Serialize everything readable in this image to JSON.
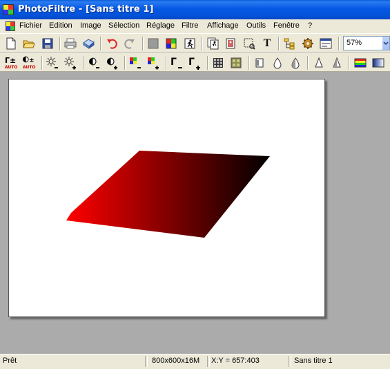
{
  "window": {
    "title": "PhotoFiltre - [Sans titre 1]"
  },
  "menu": [
    "Fichier",
    "Edition",
    "Image",
    "Sélection",
    "Réglage",
    "Filtre",
    "Affichage",
    "Outils",
    "Fenêtre",
    "?"
  ],
  "toolbar1": {
    "buttons": [
      "new-file-icon",
      "open-folder-icon",
      "save-icon",
      "print-icon",
      "scanner-icon",
      "undo-icon",
      "redo-icon",
      "gray-square-icon",
      "color-palette-icon",
      "run-icon",
      "export-icon",
      "import-icon",
      "magic-wand-icon",
      "text-tool-icon",
      "browser-icon",
      "settings-icon",
      "window-icon"
    ],
    "zoom_value": "57%",
    "text_tool_label": "T"
  },
  "toolbar2": {
    "auto_label": "AUTO",
    "buttons": [
      "auto-levels-icon",
      "auto-contrast-icon",
      "brightness-minus-icon",
      "brightness-plus-icon",
      "contrast-minus-icon",
      "contrast-plus-icon",
      "saturation-minus-icon",
      "saturation-plus-icon",
      "gamma-minus-icon",
      "gamma-plus-icon",
      "grid-icon",
      "texture-icon",
      "frame-icon",
      "blur-icon",
      "sharpen-icon",
      "drop-icon",
      "drop-plus-icon",
      "rainbow-gradient-icon",
      "blue-gradient-icon"
    ]
  },
  "canvas": {
    "background": "#FFFFFF",
    "shape_colors": [
      "#FF0000",
      "#000000"
    ]
  },
  "status": {
    "state": "Prêt",
    "image_info": "800x600x16M",
    "cursor": "X:Y = 657:403",
    "doc_name": "Sans titre 1"
  }
}
